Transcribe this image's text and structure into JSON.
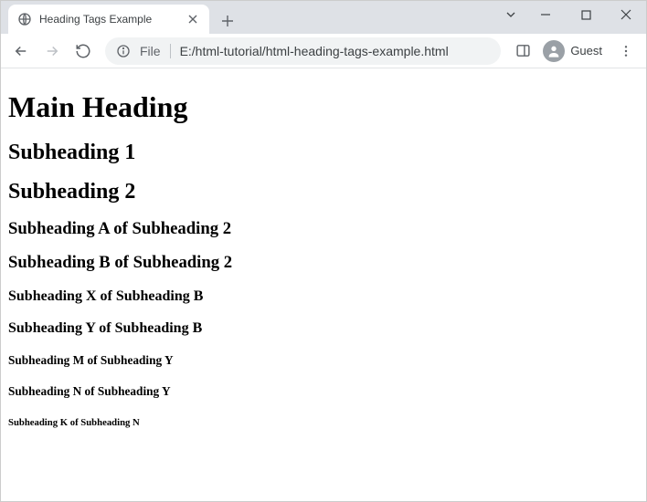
{
  "window": {
    "tab_title": "Heading Tags Example"
  },
  "toolbar": {
    "file_label": "File",
    "url": "E:/html-tutorial/html-heading-tags-example.html",
    "guest_label": "Guest"
  },
  "content": {
    "h1": "Main Heading",
    "h2_1": "Subheading 1",
    "h2_2": "Subheading 2",
    "h3_1": "Subheading A of Subheading 2",
    "h3_2": "Subheading B of Subheading 2",
    "h4_1": "Subheading X of Subheading B",
    "h4_2": "Subheading Y of Subheading B",
    "h5_1": "Subheading M of Subheading Y",
    "h5_2": "Subheading N of Subheading Y",
    "h6_1": "Subheading K of Subheading N"
  }
}
